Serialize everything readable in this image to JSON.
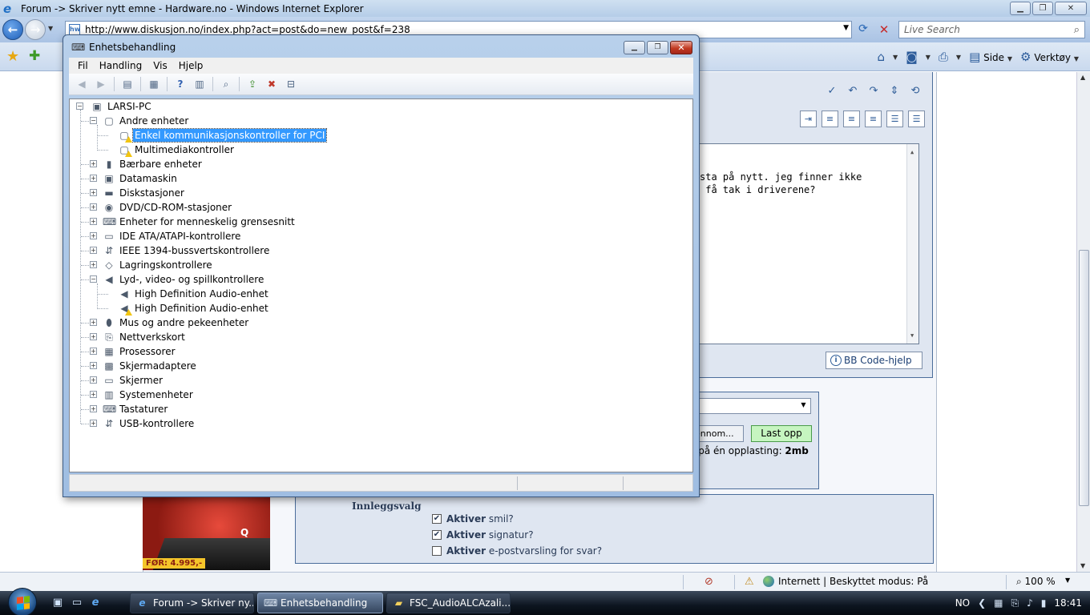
{
  "ie": {
    "title": "Forum -> Skriver nytt emne - Hardware.no - Windows Internet Explorer",
    "url": "http://www.diskusjon.no/index.php?act=post&do=new_post&f=238",
    "search_placeholder": "Live Search",
    "cmd": {
      "side": "Side",
      "verktoy": "Verktøy"
    },
    "status": {
      "zone": "Internett | Beskyttet modus: På",
      "zoom": "100 %"
    }
  },
  "page": {
    "message_line1": "sta på nytt. jeg finner ikke",
    "message_line2": " få tak i driverene?",
    "bbhelp": "BB Code-hjelp",
    "browse_label": "ennom...",
    "upload_button": "Last opp",
    "upload_note_prefix": "e på én opplasting: ",
    "upload_note_limit": "2mb",
    "ad_price": "FØR: 4.995,-",
    "ad_brand": "Q",
    "post_options": {
      "heading": "Innleggsvalg",
      "items": [
        {
          "bold": "Aktiver",
          "text": " smil?",
          "checked": true
        },
        {
          "bold": "Aktiver",
          "text": " signatur?",
          "checked": true
        },
        {
          "bold": "Aktiver",
          "text": " e-postvarsling for svar?",
          "checked": false
        }
      ]
    }
  },
  "device_manager": {
    "title": "Enhetsbehandling",
    "menu": [
      "Fil",
      "Handling",
      "Vis",
      "Hjelp"
    ],
    "root": "LARSI-PC",
    "tree": [
      {
        "label": "Andre enheter",
        "level": 1,
        "expanded": true,
        "icon": "unknown-device-icon"
      },
      {
        "label": "Enkel kommunikasjonskontroller for PCI",
        "level": 2,
        "warning": true,
        "selected": true,
        "icon": "pci-device-icon"
      },
      {
        "label": "Multimediakontroller",
        "level": 2,
        "warning": true,
        "icon": "multimedia-device-icon"
      },
      {
        "label": "Bærbare enheter",
        "level": 1,
        "icon": "portable-device-icon"
      },
      {
        "label": "Datamaskin",
        "level": 1,
        "icon": "computer-icon"
      },
      {
        "label": "Diskstasjoner",
        "level": 1,
        "icon": "disk-drive-icon"
      },
      {
        "label": "DVD/CD-ROM-stasjoner",
        "level": 1,
        "icon": "dvd-drive-icon"
      },
      {
        "label": "Enheter for menneskelig grensesnitt",
        "level": 1,
        "icon": "hid-icon"
      },
      {
        "label": "IDE ATA/ATAPI-kontrollere",
        "level": 1,
        "icon": "ide-controller-icon"
      },
      {
        "label": "IEEE 1394-bussvertskontrollere",
        "level": 1,
        "icon": "firewire-icon"
      },
      {
        "label": "Lagringskontrollere",
        "level": 1,
        "icon": "storage-controller-icon"
      },
      {
        "label": "Lyd-, video- og spillkontrollere",
        "level": 1,
        "expanded": true,
        "icon": "speaker-icon"
      },
      {
        "label": "High Definition Audio-enhet",
        "level": 2,
        "icon": "speaker-icon"
      },
      {
        "label": "High Definition Audio-enhet",
        "level": 2,
        "warning": true,
        "icon": "speaker-icon"
      },
      {
        "label": "Mus og andre pekeenheter",
        "level": 1,
        "icon": "mouse-icon"
      },
      {
        "label": "Nettverkskort",
        "level": 1,
        "icon": "network-adapter-icon"
      },
      {
        "label": "Prosessorer",
        "level": 1,
        "icon": "processor-icon"
      },
      {
        "label": "Skjermadaptere",
        "level": 1,
        "icon": "display-adapter-icon"
      },
      {
        "label": "Skjermer",
        "level": 1,
        "icon": "monitor-icon"
      },
      {
        "label": "Systemenheter",
        "level": 1,
        "icon": "system-device-icon"
      },
      {
        "label": "Tastaturer",
        "level": 1,
        "icon": "keyboard-icon"
      },
      {
        "label": "USB-kontrollere",
        "level": 1,
        "icon": "usb-icon"
      }
    ]
  },
  "taskbar": {
    "buttons": [
      {
        "label": "Forum -> Skriver ny...",
        "icon": "ie-icon",
        "active": false
      },
      {
        "label": "Enhetsbehandling",
        "icon": "device-manager-icon",
        "active": true
      },
      {
        "label": "FSC_AudioALCAzali...",
        "icon": "folder-icon",
        "active": false
      }
    ],
    "language": "NO",
    "clock": "18:41"
  }
}
